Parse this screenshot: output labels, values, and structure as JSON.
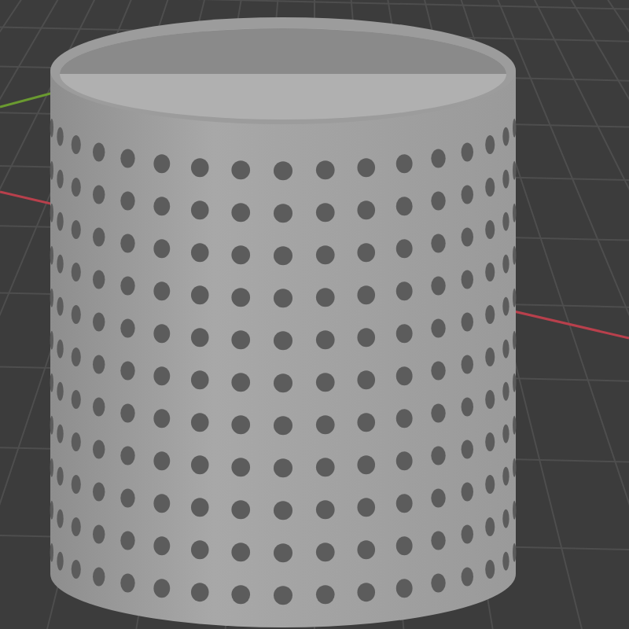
{
  "viewport": {
    "axes": [
      {
        "kind": "x",
        "color": "#b8404c"
      },
      {
        "kind": "y",
        "color": "#6a9a30"
      }
    ]
  }
}
